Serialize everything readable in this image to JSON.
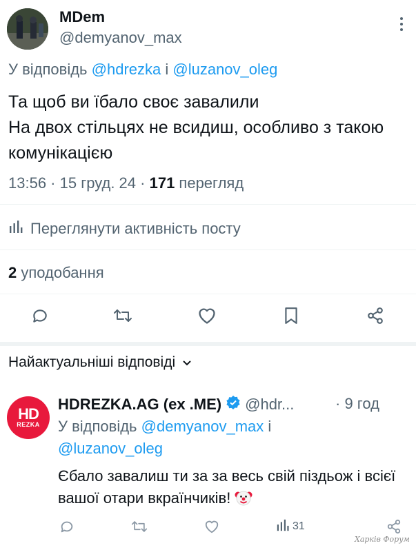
{
  "tweet": {
    "author_name": "MDem",
    "author_handle": "@demyanov_max",
    "reply_prefix": "У відповідь ",
    "reply_user1": "@hdrezka",
    "reply_join": " і ",
    "reply_user2": "@luzanov_oleg",
    "text_line1": "Та щоб ви їбало своє завалили",
    "text_line2": "На двох стільцях не всидиш, особливо з такою комунікацією",
    "time": "13:56",
    "sep1": " · ",
    "date": "15 груд. 24",
    "sep2": " · ",
    "views_count": "171",
    "views_label": " перегляд"
  },
  "activity_label": "Переглянути активність посту",
  "likes": {
    "count": "2",
    "label": " уподобання"
  },
  "actions": {
    "reply_icon": "comment-icon",
    "retweet_icon": "retweet-icon",
    "like_icon": "heart-icon",
    "bookmark_icon": "bookmark-icon",
    "share_icon": "share-icon"
  },
  "sort_label": "Найактуальніші відповіді",
  "reply": {
    "avatar_big": "HD",
    "avatar_small": "REZKA",
    "author_name": "HDREZKA.AG (ex .ME)",
    "author_handle": "@hdr...",
    "time": "· 9 год",
    "reply_prefix": "У відповідь ",
    "reply_user1": "@demyanov_max",
    "reply_join": " і ",
    "reply_user2": "@luzanov_oleg",
    "text": "Єбало завалиш ти за за весь свій піздьож і всієї вашої отари вкраїнчиків!",
    "views": "31"
  },
  "watermark": "Харків Форум",
  "colors": {
    "accent": "#1d9bf0",
    "muted": "#536471",
    "brand": "#e8193c"
  }
}
